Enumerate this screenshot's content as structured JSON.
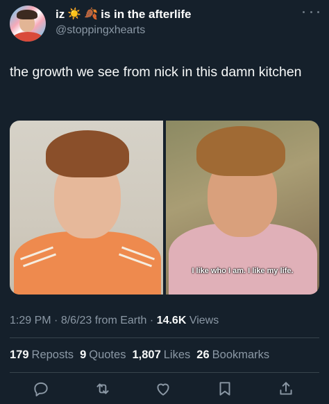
{
  "header": {
    "display_name": "iz",
    "emoji_1": "☀️",
    "emoji_2": "🍂",
    "status_text": "is in the afterlife",
    "handle": "@stoppingxhearts",
    "more_icon": "more-horizontal-icon"
  },
  "tweet": {
    "text": "the growth we see from nick in this damn kitchen"
  },
  "media": {
    "caption": "I like who I am. I like my life."
  },
  "meta": {
    "time": "1:29 PM",
    "date": "8/6/23",
    "source": "from Earth",
    "views_count": "14.6K",
    "views_label": "Views"
  },
  "stats": {
    "reposts_count": "179",
    "reposts_label": "Reposts",
    "quotes_count": "9",
    "quotes_label": "Quotes",
    "likes_count": "1,807",
    "likes_label": "Likes",
    "bookmarks_count": "26",
    "bookmarks_label": "Bookmarks"
  },
  "actions": {
    "icons": [
      "reply-icon",
      "repost-icon",
      "like-icon",
      "bookmark-icon",
      "share-icon"
    ]
  },
  "colors": {
    "background": "#15202b",
    "text_primary": "#f7f9f9",
    "text_secondary": "#8b98a5",
    "divider": "#38444d"
  }
}
